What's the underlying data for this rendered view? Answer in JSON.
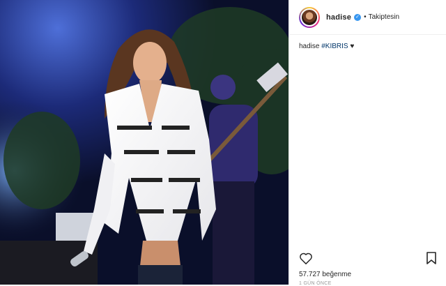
{
  "post": {
    "username": "hadise",
    "verified_icon": "verified-badge-icon",
    "separator": "•",
    "follow_status": "Takiptesin",
    "caption_user": "hadise",
    "caption_tag": "#KIBRIS",
    "caption_heart": "♥",
    "likes_count": "57.727",
    "likes_label": "beğenme",
    "time_ago": "1 GÜN ÖNCE"
  },
  "icons": {
    "like": "heart-outline-icon",
    "save": "bookmark-icon"
  },
  "colors": {
    "verified": "#3897f0",
    "hashtag": "#003569",
    "stage_bg": "#0b1230"
  }
}
